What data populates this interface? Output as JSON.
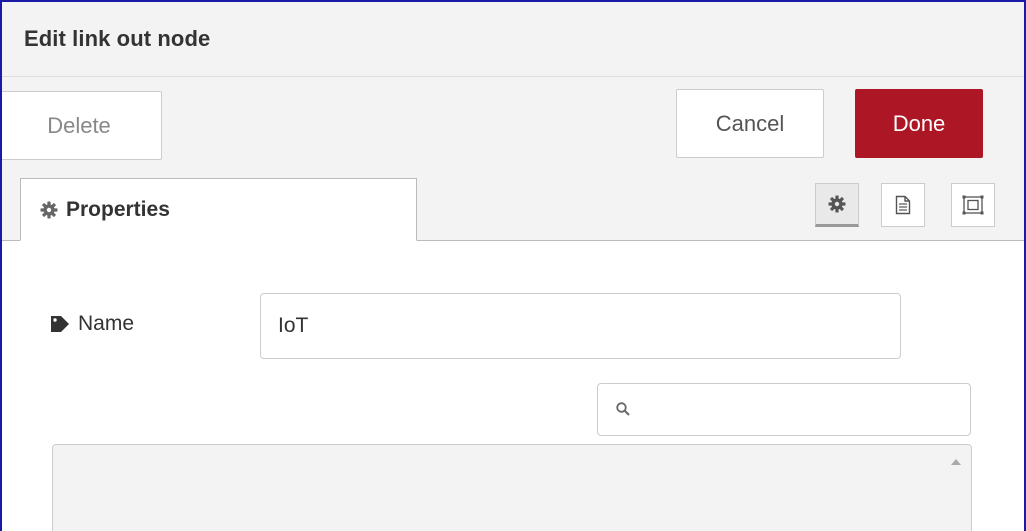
{
  "dialog": {
    "title": "Edit link out node"
  },
  "toolbar": {
    "delete_label": "Delete",
    "cancel_label": "Cancel",
    "done_label": "Done",
    "done_color": "#ad1625"
  },
  "tabs": {
    "properties_label": "Properties",
    "icon_buttons": [
      "gear-icon",
      "description-icon",
      "appearance-icon"
    ]
  },
  "form": {
    "name_label": "Name",
    "name_value": "IoT",
    "search_value": "",
    "search_placeholder": ""
  },
  "icons": {
    "properties_tab": "gear-icon",
    "name_label": "tag-icon",
    "search": "search-icon",
    "list_scroll": "scroll-up-arrow-icon"
  }
}
